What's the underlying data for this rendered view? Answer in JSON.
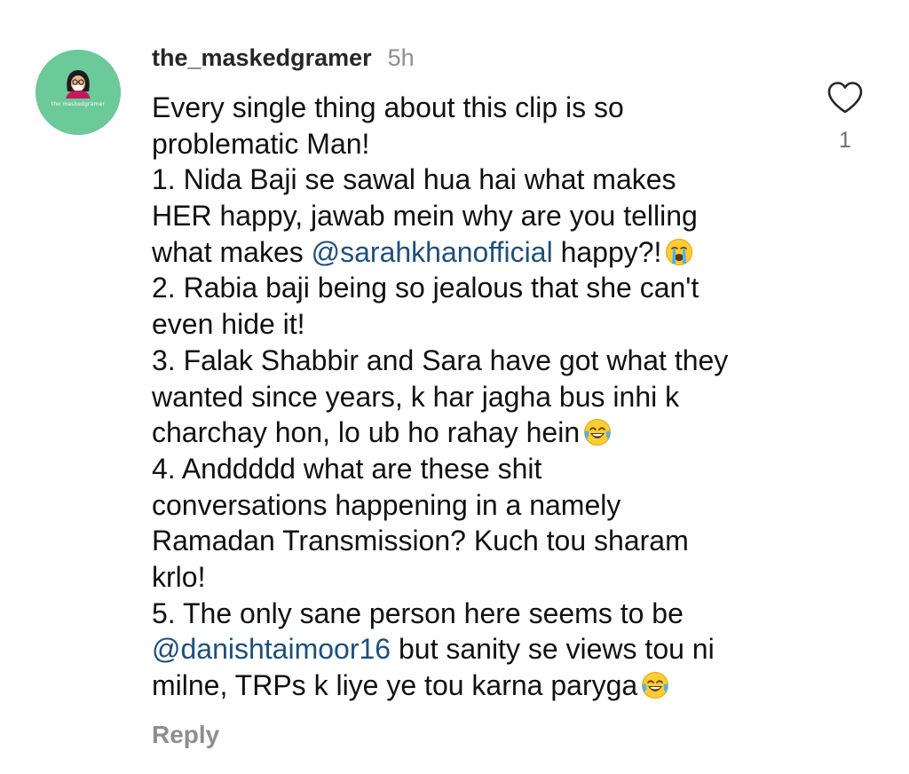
{
  "comment": {
    "username": "the_maskedgramer",
    "timestamp": "5h",
    "avatar_caption": "the maskedgramer",
    "like_count": "1",
    "reply_label": "Reply",
    "lines": [
      {
        "before": "Every single thing about this clip is so"
      },
      {
        "before": "problematic Man!"
      },
      {
        "before": "1. Nida Baji se sawal hua hai what makes"
      },
      {
        "before": "HER happy, jawab mein why are you telling"
      },
      {
        "before": "what makes ",
        "mention": "@sarahkhanofficial",
        "after": " happy?!",
        "emoji": "loudly-crying-face"
      },
      {
        "before": "2. Rabia baji being so jealous that she can't"
      },
      {
        "before": "even hide it!"
      },
      {
        "before": "3. Falak Shabbir and Sara have got what they"
      },
      {
        "before": "wanted since years, k har jagha bus inhi k"
      },
      {
        "before": "charchay hon, lo ub ho rahay hein",
        "emoji": "face-with-tears-of-joy"
      },
      {
        "before": "4. Anddddd what are these shit"
      },
      {
        "before": "conversations happening in a namely"
      },
      {
        "before": "Ramadan Transmission? Kuch tou sharam"
      },
      {
        "before": "krlo!"
      },
      {
        "before": "5. The only sane person here seems to be"
      },
      {
        "mention": "@danishtaimoor16",
        "after": " but sanity se views tou ni"
      },
      {
        "before": "milne, TRPs k liye ye tou karna paryga",
        "emoji": "face-with-tears-of-joy"
      }
    ]
  },
  "colors": {
    "avatar_bg": "#6cc99a",
    "mention": "#1e4f7c",
    "muted": "#8e8e8e",
    "text": "#111111"
  }
}
